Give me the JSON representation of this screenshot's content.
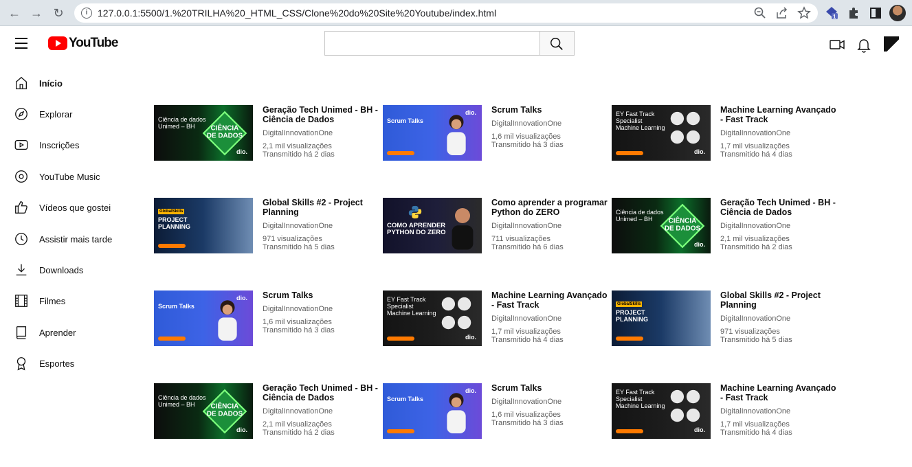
{
  "browser": {
    "url": "127.0.0.1:5500/1.%20TRILHA%20_HTML_CSS/Clone%20do%20Site%20Youtube/index.html",
    "extension_badge": "1"
  },
  "header": {
    "logo_text": "YouTube",
    "search_placeholder": ""
  },
  "sidebar": {
    "items": [
      {
        "label": "Início",
        "icon": "home-icon",
        "active": true
      },
      {
        "label": "Explorar",
        "icon": "compass-icon",
        "active": false
      },
      {
        "label": "Inscrições",
        "icon": "subscriptions-icon",
        "active": false
      },
      {
        "label": "YouTube Music",
        "icon": "music-icon",
        "active": false
      },
      {
        "label": "Vídeos que gostei",
        "icon": "thumbs-up-icon",
        "active": false
      },
      {
        "label": "Assistir mais tarde",
        "icon": "clock-icon",
        "active": false
      },
      {
        "label": "Downloads",
        "icon": "download-icon",
        "active": false
      },
      {
        "label": "Filmes",
        "icon": "film-icon",
        "active": false
      },
      {
        "label": "Aprender",
        "icon": "book-icon",
        "active": false
      },
      {
        "label": "Esportes",
        "icon": "trophy-icon",
        "active": false
      }
    ]
  },
  "videos": [
    {
      "title": "Geração Tech Unimed - BH - Ciência de Dados",
      "channel": "DigitalInnovationOne",
      "views": "2,1 mil visualizações",
      "age": "Transmitido há 2 dias",
      "thumb": "cd",
      "thumb_text": "Ciência de dados Unimed – BH",
      "thumb_badge": "dio."
    },
    {
      "title": "Scrum Talks",
      "channel": "DigitalInnovationOne",
      "views": "1,6 mil visualizações",
      "age": "Transmitido há 3 dias",
      "thumb": "scrum",
      "thumb_text": "Scrum Talks",
      "thumb_badge": "dio."
    },
    {
      "title": "Machine Learning Avançado - Fast Track",
      "channel": "DigitalInnovationOne",
      "views": "1,7 mil visualizações",
      "age": "Transmitido há 4 dias",
      "thumb": "ml",
      "thumb_text": "EY Fast Track Specialist Machine Learning",
      "thumb_badge": "dio."
    },
    {
      "title": "Global Skills #2 - Project Planning",
      "channel": "DigitalInnovationOne",
      "views": "971 visualizações",
      "age": "Transmitido há 5 dias",
      "thumb": "gs",
      "thumb_text": "PROJECT PLANNING",
      "thumb_badge": "GlobalSkills"
    },
    {
      "title": "Como aprender a programar Python do ZERO",
      "channel": "DigitalInnovationOne",
      "views": "711 visualizações",
      "age": "Transmitido há 6 dias",
      "thumb": "py",
      "thumb_text": "COMO APRENDER PYTHON DO ZERO",
      "thumb_badge": ""
    },
    {
      "title": "Geração Tech Unimed - BH - Ciência de Dados",
      "channel": "DigitalInnovationOne",
      "views": "2,1 mil visualizações",
      "age": "Transmitido há 2 dias",
      "thumb": "cd",
      "thumb_text": "Ciência de dados Unimed – BH",
      "thumb_badge": "dio."
    },
    {
      "title": "Scrum Talks",
      "channel": "DigitalInnovationOne",
      "views": "1,6 mil visualizações",
      "age": "Transmitido há 3 dias",
      "thumb": "scrum",
      "thumb_text": "Scrum Talks",
      "thumb_badge": "dio."
    },
    {
      "title": "Machine Learning Avançado - Fast Track",
      "channel": "DigitalInnovationOne",
      "views": "1,7 mil visualizações",
      "age": "Transmitido há 4 dias",
      "thumb": "ml",
      "thumb_text": "EY Fast Track Specialist Machine Learning",
      "thumb_badge": "dio."
    },
    {
      "title": "Global Skills #2 - Project Planning",
      "channel": "DigitalInnovationOne",
      "views": "971 visualizações",
      "age": "Transmitido há 5 dias",
      "thumb": "gs",
      "thumb_text": "PROJECT PLANNING",
      "thumb_badge": "GlobalSkills"
    },
    {
      "title": "Geração Tech Unimed - BH - Ciência de Dados",
      "channel": "DigitalInnovationOne",
      "views": "2,1 mil visualizações",
      "age": "Transmitido há 2 dias",
      "thumb": "cd",
      "thumb_text": "Ciência de dados Unimed – BH",
      "thumb_badge": "dio."
    },
    {
      "title": "Scrum Talks",
      "channel": "DigitalInnovationOne",
      "views": "1,6 mil visualizações",
      "age": "Transmitido há 3 dias",
      "thumb": "scrum",
      "thumb_text": "Scrum Talks",
      "thumb_badge": "dio."
    },
    {
      "title": "Machine Learning Avançado - Fast Track",
      "channel": "DigitalInnovationOne",
      "views": "1,7 mil visualizações",
      "age": "Transmitido há 4 dias",
      "thumb": "ml",
      "thumb_text": "EY Fast Track Specialist Machine Learning",
      "thumb_badge": "dio."
    }
  ]
}
